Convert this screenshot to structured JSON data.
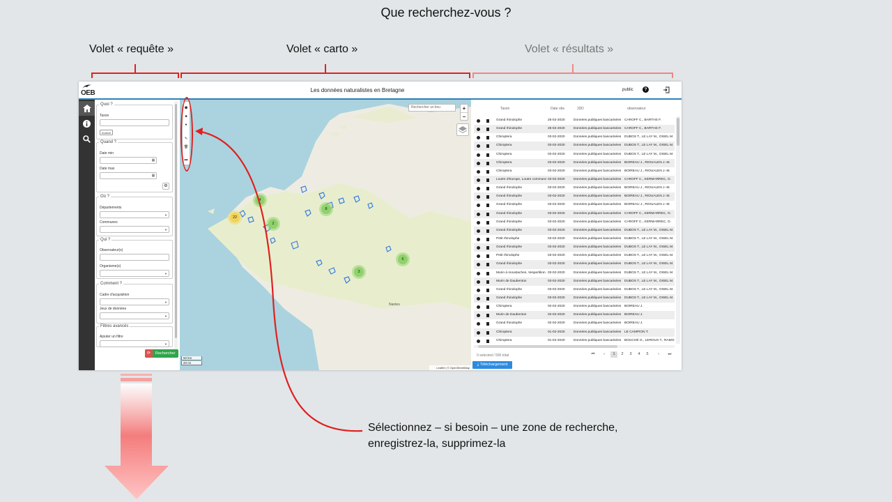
{
  "slide": {
    "title": "Que recherchez-vous  ?",
    "volet_requete": "Volet « requête »",
    "volet_carto": "Volet « carto »",
    "volet_resultats": "Volet « résultats »",
    "annotation_line1": "Sélectionnez – si besoin – une zone de recherche,",
    "annotation_line2": "enregistrez-la, supprimez-la",
    "accent_color": "#e02020"
  },
  "app": {
    "logo": "OEB",
    "title": "Les données naturalistes en Bretagne",
    "user": "public",
    "help_icon": "?",
    "nav": [
      "home-icon",
      "info-icon",
      "search-icon"
    ]
  },
  "query": {
    "quoi": {
      "legend": "Quoi ?",
      "taxon_label": "Taxon",
      "avance_label": "Avancé"
    },
    "quand": {
      "legend": "Quand ?",
      "date_min_label": "Date min",
      "date_max_label": "Date max"
    },
    "ou": {
      "legend": "Où ?",
      "departements_label": "Départements",
      "communes_label": "Communes"
    },
    "qui": {
      "legend": "Qui ?",
      "observateurs_label": "Observateur(s)",
      "organismes_label": "Organisme(s)"
    },
    "comment": {
      "legend": "Comment ?",
      "cadre_label": "Cadre d'acquisition",
      "jeux_label": "Jeux de données"
    },
    "filtres": {
      "legend": "Filtres avancés",
      "ajouter_label": "Ajouter un filtre"
    },
    "search_button": "Rechercher"
  },
  "map": {
    "search_placeholder": "Rechercher un lieu",
    "zoom_in": "+",
    "zoom_out": "−",
    "scale_km": "50 km",
    "scale_mi": "20 mi",
    "attribution": "Leaflet | © OpenStreetMap",
    "city_label": "Nantes",
    "clusters": [
      {
        "count": "22",
        "color": "yellow"
      },
      {
        "count": "4",
        "color": "green"
      },
      {
        "count": "2",
        "color": "green"
      },
      {
        "count": "8",
        "color": "green"
      },
      {
        "count": "6",
        "color": "green"
      },
      {
        "count": "3",
        "color": "green"
      }
    ]
  },
  "results": {
    "headers": {
      "taxon": "Taxon",
      "date": "Date obs",
      "jdd": "JDD",
      "observateur": "observateur"
    },
    "rows": [
      {
        "taxon": "Grand rhinolophe",
        "date": "25-02-2020",
        "jdd": "Données publiques bancarisées",
        "obs": "CAROFF C., BARTHS F."
      },
      {
        "taxon": "Grand rhinolophe",
        "date": "25-02-2020",
        "jdd": "Données publiques bancarisées",
        "obs": "CAROFF C., BARTHS F."
      },
      {
        "taxon": "Chiroptera",
        "date": "03-02-2020",
        "jdd": "Données publiques bancarisées",
        "obs": "DUBOS T., LE LAY M., OISEL M."
      },
      {
        "taxon": "Chiroptera",
        "date": "03-02-2020",
        "jdd": "Données publiques bancarisées",
        "obs": "DUBOS T., LE LAY M., OISEL M."
      },
      {
        "taxon": "Chiroptera",
        "date": "03-02-2020",
        "jdd": "Données publiques bancarisées",
        "obs": "DUBOS T., LE LAY M., OISEL M."
      },
      {
        "taxon": "Chiroptera",
        "date": "03-02-2020",
        "jdd": "Données publiques bancarisées",
        "obs": "BOIREAU J., RIOUALEN J.-M."
      },
      {
        "taxon": "Chiroptera",
        "date": "03-02-2020",
        "jdd": "Données publiques bancarisées",
        "obs": "BOIREAU J., RIOUALEN J.-M."
      },
      {
        "taxon": "Loutre d'Europe, Loutre commune",
        "date": "03-02-2020",
        "jdd": "Données publiques bancarisées",
        "obs": "CAROFF C., KERMARREC, O."
      },
      {
        "taxon": "Grand rhinolophe",
        "date": "03-02-2020",
        "jdd": "Données publiques bancarisées",
        "obs": "BOIREAU J., RIOUALEN J.-M."
      },
      {
        "taxon": "Grand rhinolophe",
        "date": "03-02-2020",
        "jdd": "Données publiques bancarisées",
        "obs": "BOIREAU J., RIOUALEN J.-M."
      },
      {
        "taxon": "Grand rhinolophe",
        "date": "03-02-2020",
        "jdd": "Données publiques bancarisées",
        "obs": "BOIREAU J., RIOUALEN J.-M."
      },
      {
        "taxon": "Grand rhinolophe",
        "date": "03-02-2020",
        "jdd": "Données publiques bancarisées",
        "obs": "CAROFF C., KERMARREC, O."
      },
      {
        "taxon": "Grand rhinolophe",
        "date": "03-02-2020",
        "jdd": "Données publiques bancarisées",
        "obs": "CAROFF C., KERMARREC, O."
      },
      {
        "taxon": "Grand rhinolophe",
        "date": "03-02-2020",
        "jdd": "Données publiques bancarisées",
        "obs": "DUBOS T., LE LAY M., OISEL M."
      },
      {
        "taxon": "Petit rhinolophe",
        "date": "03-02-2020",
        "jdd": "Données publiques bancarisées",
        "obs": "DUBOS T., LE LAY M., OISEL M."
      },
      {
        "taxon": "Grand rhinolophe",
        "date": "03-02-2020",
        "jdd": "Données publiques bancarisées",
        "obs": "DUBOS T., LE LAY M., OISEL M."
      },
      {
        "taxon": "Petit rhinolophe",
        "date": "03-02-2020",
        "jdd": "Données publiques bancarisées",
        "obs": "DUBOS T., LE LAY M., OISEL M."
      },
      {
        "taxon": "Grand rhinolophe",
        "date": "03-02-2020",
        "jdd": "Données publiques bancarisées",
        "obs": "DUBOS T., LE LAY M., OISEL M."
      },
      {
        "taxon": "Murin à moustaches, Vespertilion à moustaches",
        "date": "03-02-2020",
        "jdd": "Données publiques bancarisées",
        "obs": "DUBOS T., LE LAY M., OISEL M."
      },
      {
        "taxon": "Murin de Daubenton",
        "date": "03-02-2020",
        "jdd": "Données publiques bancarisées",
        "obs": "DUBOS T., LE LAY M., OISEL M."
      },
      {
        "taxon": "Grand rhinolophe",
        "date": "03-02-2020",
        "jdd": "Données publiques bancarisées",
        "obs": "DUBOS T., LE LAY M., OISEL M."
      },
      {
        "taxon": "Grand rhinolophe",
        "date": "03-02-2020",
        "jdd": "Données publiques bancarisées",
        "obs": "DUBOS T., LE LAY M., OISEL M."
      },
      {
        "taxon": "Chiroptera",
        "date": "02-02-2020",
        "jdd": "Données publiques bancarisées",
        "obs": "BOIREAU J."
      },
      {
        "taxon": "Murin de Daubenton",
        "date": "02-02-2020",
        "jdd": "Données publiques bancarisées",
        "obs": "BOIREAU J."
      },
      {
        "taxon": "Grand rhinolophe",
        "date": "02-02-2020",
        "jdd": "Données publiques bancarisées",
        "obs": "BOIREAU J."
      },
      {
        "taxon": "Chiroptera",
        "date": "01-02-2020",
        "jdd": "Données publiques bancarisées",
        "obs": "LE CAMPION T."
      },
      {
        "taxon": "Chiroptera",
        "date": "01-02-2020",
        "jdd": "Données publiques bancarisées",
        "obs": "BOUCHÉ G., LEROUX T., RAMOS"
      }
    ],
    "selected_info": "0 selected / 500 total",
    "pages": [
      "1",
      "2",
      "3",
      "4",
      "5"
    ],
    "download_button": "Téléchargement"
  }
}
